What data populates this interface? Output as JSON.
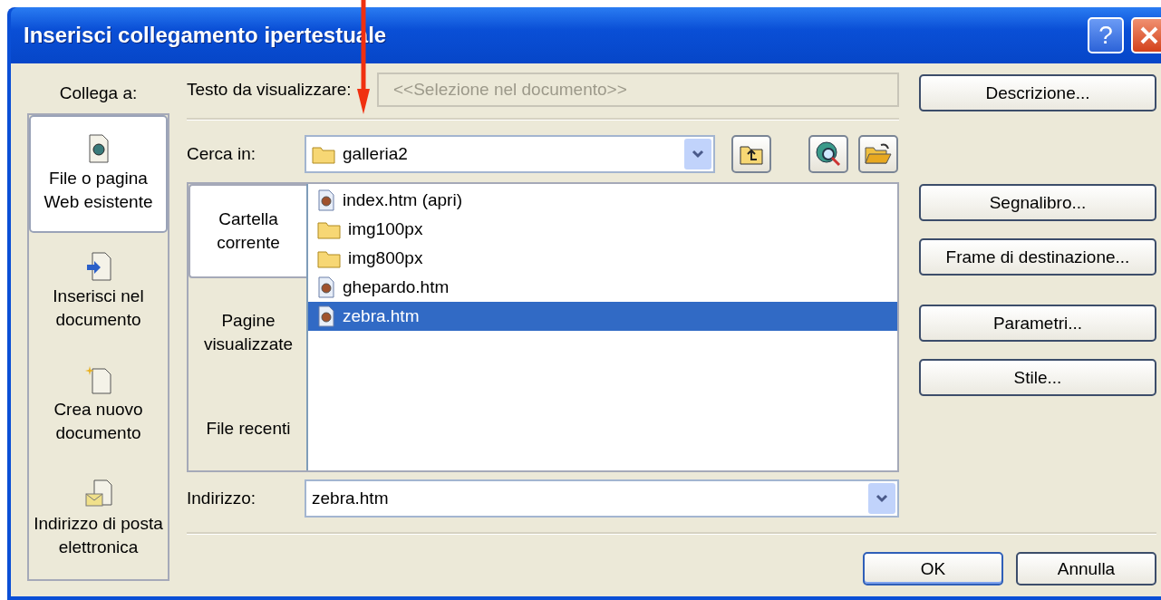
{
  "window": {
    "title": "Inserisci collegamento ipertestuale",
    "help_button": "?"
  },
  "sidebar": {
    "label": "Collega a:",
    "items": [
      {
        "kind": "web",
        "label": "File o pagina Web esistente",
        "selected": true
      },
      {
        "kind": "place",
        "label": "Inserisci nel documento",
        "selected": false
      },
      {
        "kind": "new",
        "label": "Crea nuovo documento",
        "selected": false
      },
      {
        "kind": "email",
        "label": "Indirizzo di posta elettronica",
        "selected": false
      }
    ]
  },
  "display_text": {
    "label": "Testo da visualizzare:",
    "value": "<<Selezione nel documento>>",
    "disabled": true
  },
  "look_in": {
    "label": "Cerca in:",
    "value": "galleria2"
  },
  "browse_tabs": [
    {
      "label": "Cartella corrente",
      "selected": true
    },
    {
      "label": "Pagine visualizzate",
      "selected": false
    },
    {
      "label": "File recenti",
      "selected": false
    }
  ],
  "files": [
    {
      "kind": "htm",
      "name": "index.htm (apri)",
      "selected": false
    },
    {
      "kind": "folder",
      "name": "img100px",
      "selected": false
    },
    {
      "kind": "folder",
      "name": "img800px",
      "selected": false
    },
    {
      "kind": "htm",
      "name": "ghepardo.htm",
      "selected": false
    },
    {
      "kind": "htm",
      "name": "zebra.htm",
      "selected": true
    }
  ],
  "address": {
    "label": "Indirizzo:",
    "value": "zebra.htm"
  },
  "side_buttons": [
    "Descrizione...",
    "Segnalibro...",
    "Frame di destinazione...",
    "Parametri...",
    "Stile..."
  ],
  "footer_buttons": [
    {
      "label": "OK",
      "default": true
    },
    {
      "label": "Annulla",
      "default": false
    }
  ]
}
